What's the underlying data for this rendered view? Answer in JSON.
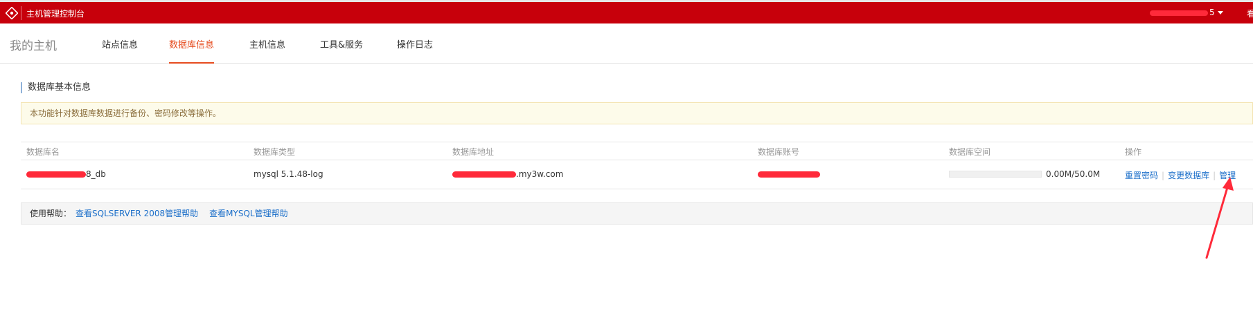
{
  "header": {
    "app_title": "主机管理控制台",
    "user_label": "5",
    "extra": "看"
  },
  "nav": {
    "title": "我的主机",
    "tabs": [
      {
        "label": "站点信息"
      },
      {
        "label": "数据库信息"
      },
      {
        "label": "主机信息"
      },
      {
        "label": "工具&服务"
      },
      {
        "label": "操作日志"
      }
    ],
    "active_tab": "数据库信息"
  },
  "section": {
    "title": "数据库基本信息",
    "notice": "本功能针对数据库数据进行备份、密码修改等操作。"
  },
  "table": {
    "headers": [
      "数据库名",
      "数据库类型",
      "数据库地址",
      "数据库账号",
      "数据库空间",
      "操作"
    ],
    "rows": [
      {
        "name_suffix": "8_db",
        "type": "mysql 5.1.48-log",
        "address_suffix": ".my3w.com",
        "space": "0.00M/50.0M",
        "space_used_fraction": 0.0,
        "actions": [
          "重置密码",
          "变更数据库",
          "管理"
        ]
      }
    ]
  },
  "help": {
    "label": "使用帮助：",
    "links": [
      "查看SQLSERVER 2008管理帮助",
      "查看MYSQL管理帮助"
    ]
  },
  "colors": {
    "brand_red": "#c7000b",
    "active_tab": "#e64b1e",
    "link": "#1a6ec9",
    "annotation_red": "#ff2a3a"
  }
}
